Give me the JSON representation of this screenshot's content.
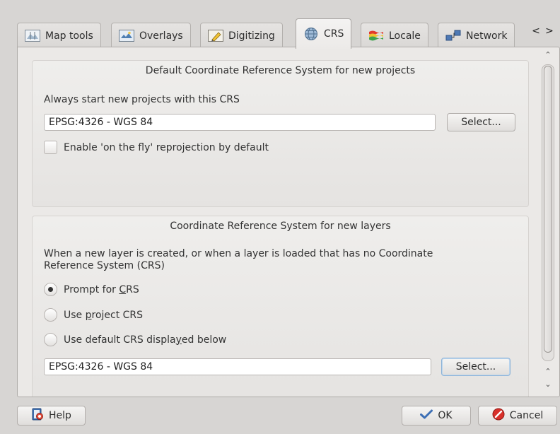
{
  "tabs": [
    {
      "label": "Map tools",
      "icon": "map-tools-icon"
    },
    {
      "label": "Overlays",
      "icon": "overlays-icon"
    },
    {
      "label": "Digitizing",
      "icon": "digitizing-icon"
    },
    {
      "label": "CRS",
      "icon": "globe-icon",
      "active": true
    },
    {
      "label": "Locale",
      "icon": "locale-flag-icon"
    },
    {
      "label": "Network",
      "icon": "network-icon"
    }
  ],
  "tab_scroll": {
    "left": "<",
    "right": ">"
  },
  "default_crs": {
    "title": "Default Coordinate Reference System for new projects",
    "always_start_label": "Always start new projects with this CRS",
    "crs_value": "EPSG:4326 - WGS 84",
    "select_label": "Select...",
    "otf_checkbox_label": "Enable 'on the fly' reprojection by default",
    "otf_checked": false
  },
  "new_layers": {
    "title": "Coordinate Reference System for new layers",
    "description_line1": "When a new layer is created, or when a layer is loaded that has no Coordinate",
    "description_line2": "Reference System (CRS)",
    "options": [
      {
        "pre": "Prompt for ",
        "mnemonic": "C",
        "post": "RS",
        "selected": true
      },
      {
        "pre": "Use ",
        "mnemonic": "p",
        "post": "roject CRS",
        "selected": false
      },
      {
        "pre": "Use default CRS displa",
        "mnemonic": "y",
        "post": "ed below",
        "selected": false
      }
    ],
    "crs_value": "EPSG:4326 - WGS 84",
    "select_label": "Select..."
  },
  "footer": {
    "help_label": "Help",
    "ok_label": "OK",
    "cancel_label": "Cancel"
  },
  "colors": {
    "window_bg": "#d7d5d3",
    "panel_bg": "#ebe9e7",
    "focus_border": "#8db3d8",
    "cancel_icon": "#d9302a",
    "ok_check": "#3d6fb5"
  }
}
